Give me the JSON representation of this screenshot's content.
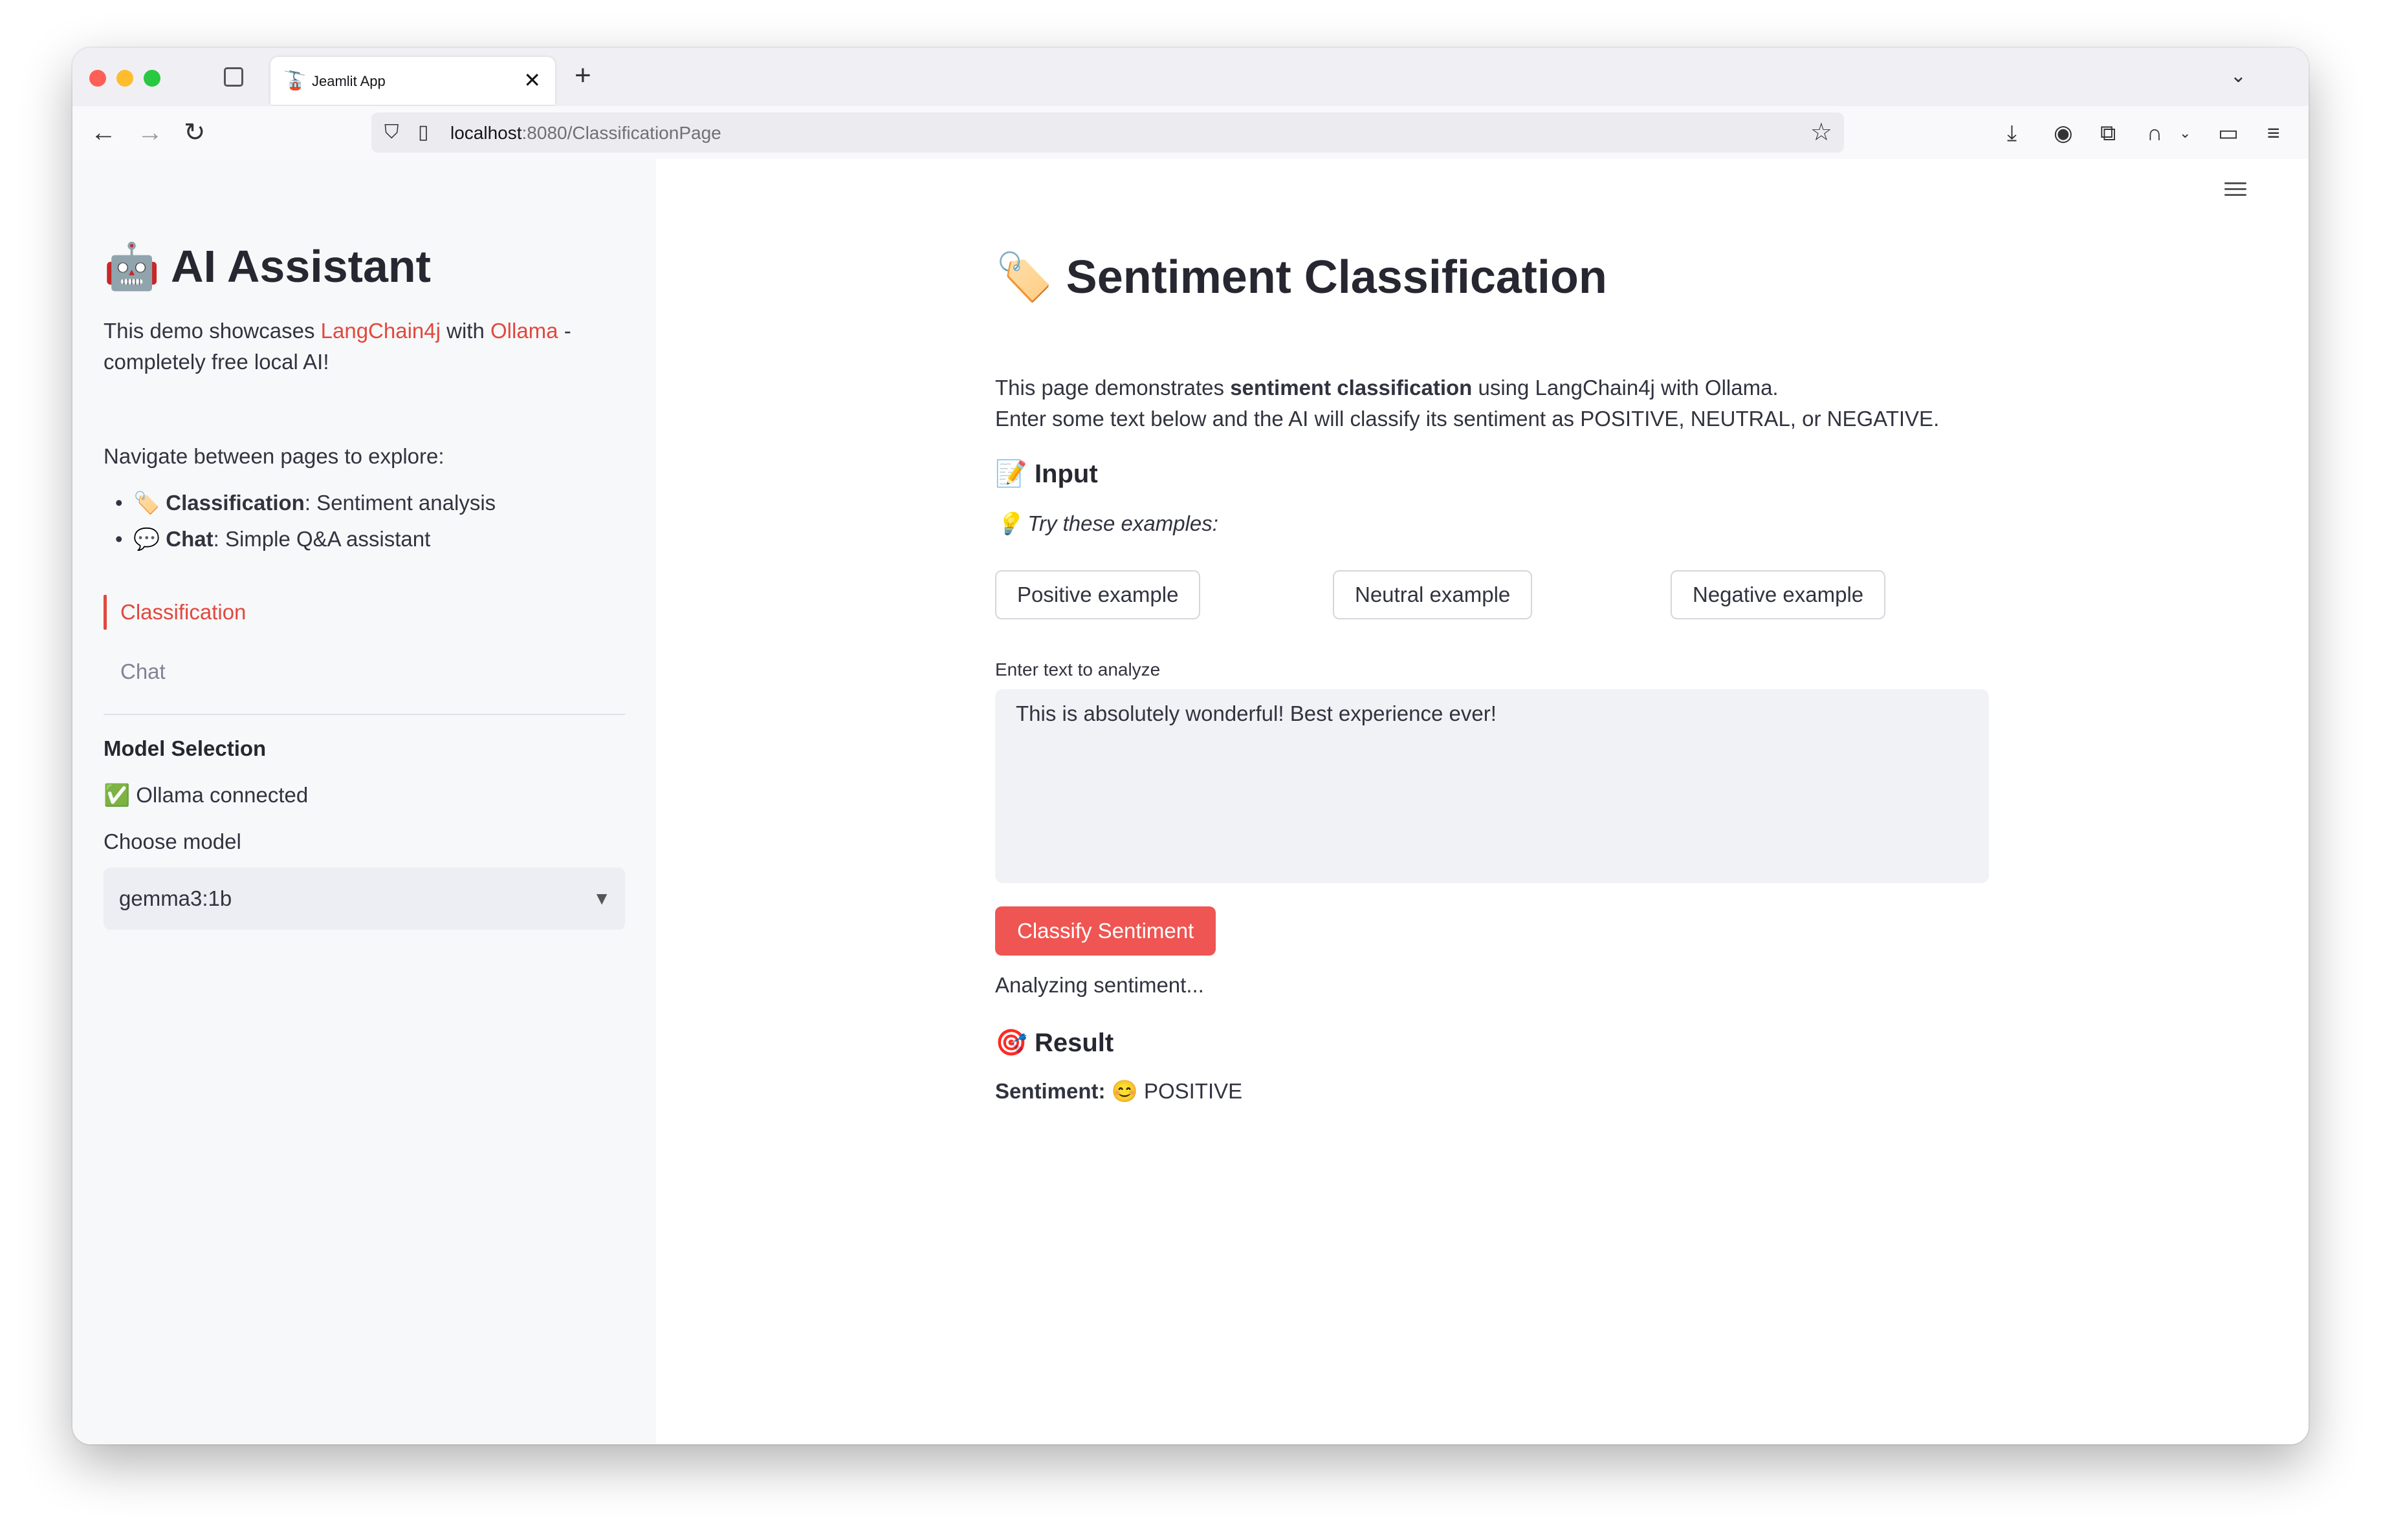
{
  "browser": {
    "tab_title": "Jeamlit App",
    "tab_favicon": "🚡",
    "url_host": "localhost",
    "url_rest": ":8080/ClassificationPage"
  },
  "sidebar": {
    "title_emoji": "🤖",
    "title": "AI Assistant",
    "intro_prefix": "This demo showcases ",
    "intro_link1": "LangChain4j",
    "intro_mid": " with ",
    "intro_link2": "Ollama",
    "intro_suffix": " - completely free local AI!",
    "navigate_text": "Navigate between pages to explore:",
    "bullets": [
      {
        "emoji": "🏷️",
        "bold": "Classification",
        "rest": ": Sentiment analysis"
      },
      {
        "emoji": "💬",
        "bold": "Chat",
        "rest": ": Simple Q&A assistant"
      }
    ],
    "nav": [
      {
        "label": "Classification",
        "active": true
      },
      {
        "label": "Chat",
        "active": false
      }
    ],
    "model_heading": "Model Selection",
    "status_emoji": "✅",
    "status_text": "Ollama connected",
    "choose_label": "Choose model",
    "model_value": "gemma3:1b"
  },
  "main": {
    "title_emoji": "🏷️",
    "title": "Sentiment Classification",
    "desc1_prefix": "This page demonstrates ",
    "desc1_bold": "sentiment classification",
    "desc1_suffix": " using LangChain4j with Ollama.",
    "desc2": "Enter some text below and the AI will classify its sentiment as POSITIVE, NEUTRAL, or NEGATIVE.",
    "input_emoji": "📝",
    "input_heading": "Input",
    "examples_emoji": "💡",
    "examples_label": "Try these examples:",
    "example_buttons": [
      "Positive example",
      "Neutral example",
      "Negative example"
    ],
    "field_label": "Enter text to analyze",
    "field_value": "This is absolutely wonderful! Best experience ever!",
    "classify_label": "Classify Sentiment",
    "analyzing_text": "Analyzing sentiment...",
    "result_emoji": "🎯",
    "result_heading": "Result",
    "sentiment_label": "Sentiment:",
    "sentiment_emoji": "😊",
    "sentiment_value": "POSITIVE"
  },
  "colors": {
    "accent": "#ef5552",
    "link": "#e2483d",
    "sidebar_bg": "#f7f8fa"
  }
}
